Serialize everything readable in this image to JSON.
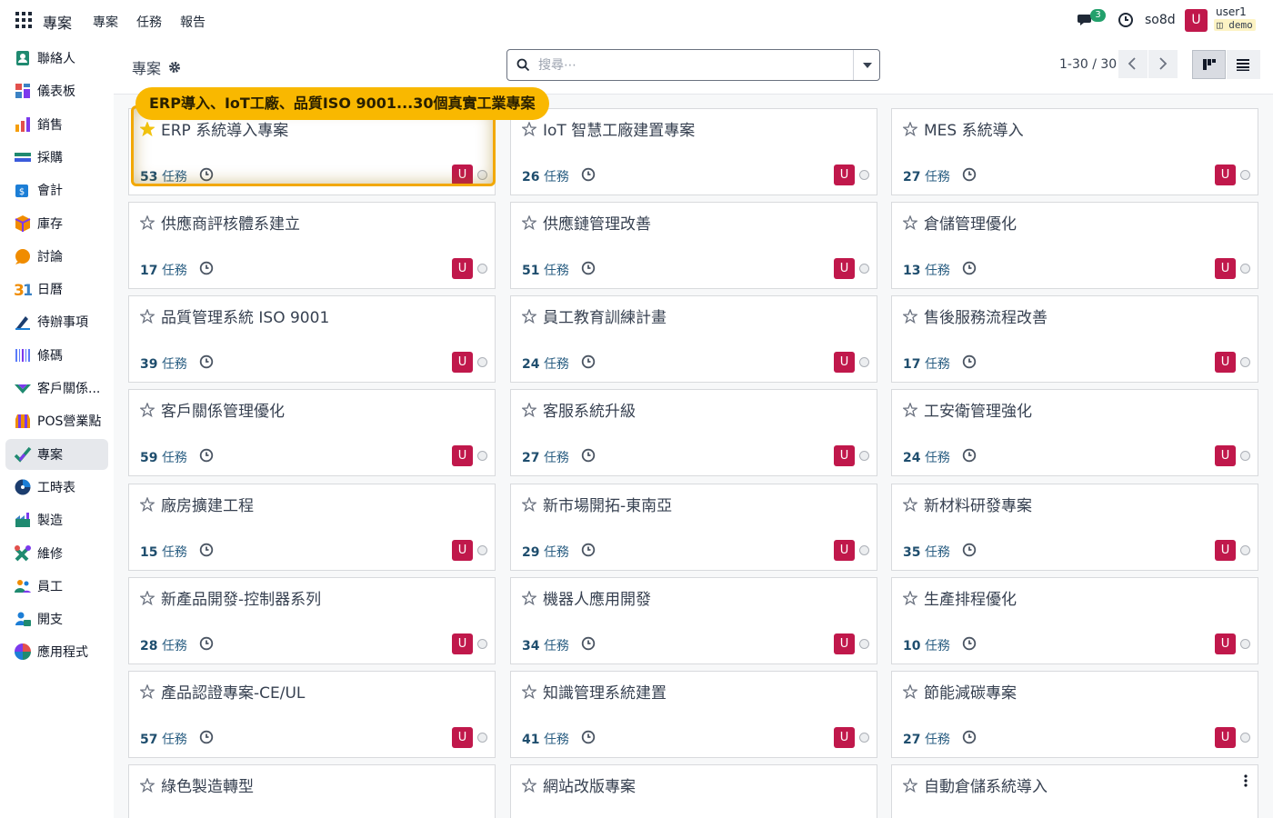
{
  "app": {
    "brand": "專案",
    "menu": [
      "專案",
      "任務",
      "報告"
    ]
  },
  "systray": {
    "chat_count": "3",
    "db_name": "so8d",
    "avatar_letter": "U",
    "user_name": "user1",
    "user_db": "demo"
  },
  "sidebar": {
    "items": [
      {
        "label": "聯絡人",
        "icon": "contacts-icon"
      },
      {
        "label": "儀表板",
        "icon": "dashboard-icon"
      },
      {
        "label": "銷售",
        "icon": "sales-icon"
      },
      {
        "label": "採購",
        "icon": "purchase-icon"
      },
      {
        "label": "會計",
        "icon": "accounting-icon"
      },
      {
        "label": "庫存",
        "icon": "inventory-icon"
      },
      {
        "label": "討論",
        "icon": "discuss-icon"
      },
      {
        "label": "日曆",
        "icon": "calendar-icon"
      },
      {
        "label": "待辦事項",
        "icon": "todo-icon"
      },
      {
        "label": "條碼",
        "icon": "barcode-icon"
      },
      {
        "label": "客戶關係...",
        "icon": "crm-icon"
      },
      {
        "label": "POS營業點",
        "icon": "pos-icon"
      },
      {
        "label": "專案",
        "icon": "project-icon"
      },
      {
        "label": "工時表",
        "icon": "timesheet-icon"
      },
      {
        "label": "製造",
        "icon": "manufacturing-icon"
      },
      {
        "label": "維修",
        "icon": "repair-icon"
      },
      {
        "label": "員工",
        "icon": "employees-icon"
      },
      {
        "label": "開支",
        "icon": "expenses-icon"
      },
      {
        "label": "應用程式",
        "icon": "apps-icon"
      }
    ],
    "active_index": 12
  },
  "control": {
    "breadcrumb": "專案",
    "search_placeholder": "搜尋⋯",
    "pager": "1-30 / 30"
  },
  "tooltip": {
    "text": "ERP導入、IoT工廠、品質ISO 9001...30個真實工業專案"
  },
  "task_unit": "任務",
  "projects": [
    {
      "title": "ERP 系統導入專案",
      "count": "53",
      "starred": true
    },
    {
      "title": "IoT 智慧工廠建置專案",
      "count": "26",
      "starred": false
    },
    {
      "title": "MES 系統導入",
      "count": "27",
      "starred": false
    },
    {
      "title": "供應商評核體系建立",
      "count": "17",
      "starred": false
    },
    {
      "title": "供應鏈管理改善",
      "count": "51",
      "starred": false
    },
    {
      "title": "倉儲管理優化",
      "count": "13",
      "starred": false
    },
    {
      "title": "品質管理系統 ISO 9001",
      "count": "39",
      "starred": false
    },
    {
      "title": "員工教育訓練計畫",
      "count": "24",
      "starred": false
    },
    {
      "title": "售後服務流程改善",
      "count": "17",
      "starred": false
    },
    {
      "title": "客戶關係管理優化",
      "count": "59",
      "starred": false
    },
    {
      "title": "客服系統升級",
      "count": "27",
      "starred": false
    },
    {
      "title": "工安衛管理強化",
      "count": "24",
      "starred": false
    },
    {
      "title": "廠房擴建工程",
      "count": "15",
      "starred": false
    },
    {
      "title": "新市場開拓-東南亞",
      "count": "29",
      "starred": false
    },
    {
      "title": "新材料研發專案",
      "count": "35",
      "starred": false
    },
    {
      "title": "新產品開發-控制器系列",
      "count": "28",
      "starred": false
    },
    {
      "title": "機器人應用開發",
      "count": "34",
      "starred": false
    },
    {
      "title": "生產排程優化",
      "count": "10",
      "starred": false
    },
    {
      "title": "產品認證專案-CE/UL",
      "count": "57",
      "starred": false
    },
    {
      "title": "知識管理系統建置",
      "count": "41",
      "starred": false
    },
    {
      "title": "節能減碳專案",
      "count": "27",
      "starred": false
    },
    {
      "title": "綠色製造轉型",
      "count": "",
      "starred": false
    },
    {
      "title": "網站改版專案",
      "count": "",
      "starred": false
    },
    {
      "title": "自動倉儲系統導入",
      "count": "",
      "starred": false
    }
  ],
  "colors": {
    "avatar": "#c0184b",
    "tooltip": "#f9b800",
    "star_active": "#f3c40f"
  }
}
